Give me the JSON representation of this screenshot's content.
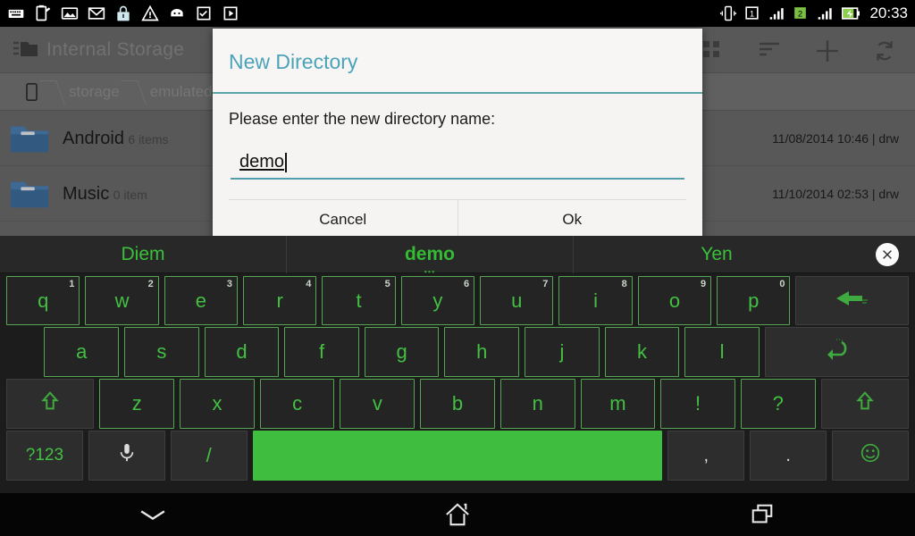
{
  "statusbar": {
    "left_icons": [
      {
        "name": "keyboard-active-icon",
        "label": "keyboard"
      },
      {
        "name": "note-icon",
        "label": "note"
      },
      {
        "name": "gallery-icon",
        "label": "gallery"
      },
      {
        "name": "gmail-icon",
        "label": "gmail"
      },
      {
        "name": "lock-icon",
        "label": "lock"
      },
      {
        "name": "warning-icon",
        "label": "warning"
      },
      {
        "name": "robot-icon",
        "label": "android update"
      },
      {
        "name": "app-install-check-icon",
        "label": "install complete"
      },
      {
        "name": "app-install-icon",
        "label": "installing"
      }
    ],
    "right_icons": [
      {
        "name": "vibrate-icon",
        "label": "vibrate"
      },
      {
        "name": "sim1-icon",
        "label": "1"
      },
      {
        "name": "signal1-icon",
        "label": "signal sim 1"
      },
      {
        "name": "sim2-icon",
        "label": "2"
      },
      {
        "name": "signal2-icon",
        "label": "signal sim 2"
      },
      {
        "name": "battery-charging-icon",
        "label": "charging"
      }
    ],
    "clock": "20:33"
  },
  "app": {
    "title": "Internal Storage",
    "actions": [
      {
        "name": "grid-view-icon",
        "label": "Grid view"
      },
      {
        "name": "sort-icon",
        "label": "Sort"
      },
      {
        "name": "add-icon",
        "label": "Add"
      },
      {
        "name": "refresh-icon",
        "label": "Refresh"
      }
    ],
    "breadcrumb": [
      "storage",
      "emulated"
    ],
    "files": [
      {
        "name": "Android",
        "sub": "6 items",
        "date": "11/08/2014 10:46 | drw"
      },
      {
        "name": "Music",
        "sub": "0 item",
        "date": "11/10/2014 02:53 | drw"
      }
    ]
  },
  "dialog": {
    "title": "New Directory",
    "message": "Please enter the new directory name:",
    "input_value": "demo",
    "input_placeholder": "",
    "cancel_label": "Cancel",
    "ok_label": "Ok",
    "accent_color": "#4aa3b8",
    "rule_color": "#5aa3ad"
  },
  "keyboard": {
    "suggestions": [
      {
        "text": "Diem",
        "active": false
      },
      {
        "text": "demo",
        "active": true
      },
      {
        "text": "Yen",
        "active": false
      }
    ],
    "close_label": "✕",
    "row1": [
      {
        "key": "q",
        "hint": "1"
      },
      {
        "key": "w",
        "hint": "2"
      },
      {
        "key": "e",
        "hint": "3"
      },
      {
        "key": "r",
        "hint": "4"
      },
      {
        "key": "t",
        "hint": "5"
      },
      {
        "key": "y",
        "hint": "6"
      },
      {
        "key": "u",
        "hint": "7"
      },
      {
        "key": "i",
        "hint": "8"
      },
      {
        "key": "o",
        "hint": "9"
      },
      {
        "key": "p",
        "hint": "0"
      }
    ],
    "row1_action": {
      "name": "backspace-key",
      "label": "Backspace"
    },
    "row2": [
      "a",
      "s",
      "d",
      "f",
      "g",
      "h",
      "j",
      "k",
      "l"
    ],
    "row2_action": {
      "name": "enter-key",
      "label": "Enter"
    },
    "row3_shift_left": {
      "name": "shift-key-left",
      "label": "Shift"
    },
    "row3": [
      "z",
      "x",
      "c",
      "v",
      "b",
      "n",
      "m",
      "!",
      "?"
    ],
    "row3_shift_right": {
      "name": "shift-key-right",
      "label": "Shift"
    },
    "row4": {
      "symbols_label": "?123",
      "mic_label": "Voice input",
      "slash_label": "/",
      "space_label": "",
      "comma_label": ",",
      "period_label": ".",
      "emoji_label": "Emoji"
    },
    "accent_green": "#3ebd3e",
    "key_green": "#43c043"
  },
  "navbar": [
    {
      "name": "hide-keyboard-button",
      "label": "Hide keyboard"
    },
    {
      "name": "home-button",
      "label": "Home"
    },
    {
      "name": "recents-button",
      "label": "Recent apps"
    }
  ]
}
